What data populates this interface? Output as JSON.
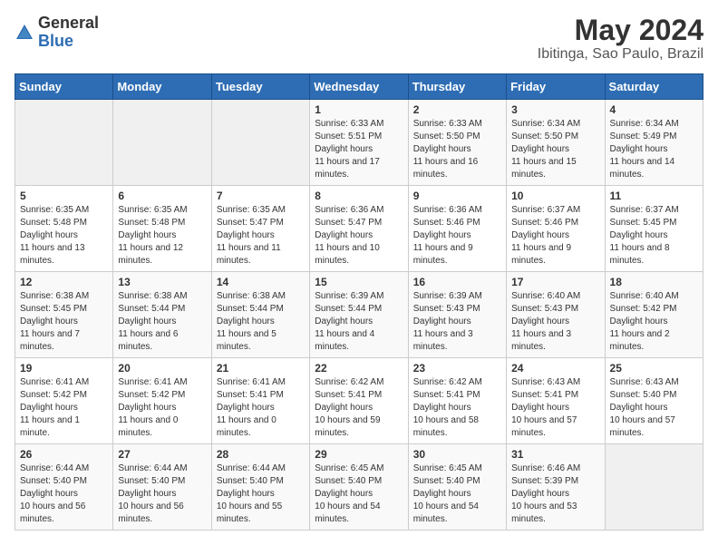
{
  "logo": {
    "general": "General",
    "blue": "Blue"
  },
  "header": {
    "title": "May 2024",
    "subtitle": "Ibitinga, Sao Paulo, Brazil"
  },
  "weekdays": [
    "Sunday",
    "Monday",
    "Tuesday",
    "Wednesday",
    "Thursday",
    "Friday",
    "Saturday"
  ],
  "weeks": [
    [
      {
        "day": "",
        "empty": true
      },
      {
        "day": "",
        "empty": true
      },
      {
        "day": "",
        "empty": true
      },
      {
        "day": "1",
        "sunrise": "6:33 AM",
        "sunset": "5:51 PM",
        "daylight": "11 hours and 17 minutes."
      },
      {
        "day": "2",
        "sunrise": "6:33 AM",
        "sunset": "5:50 PM",
        "daylight": "11 hours and 16 minutes."
      },
      {
        "day": "3",
        "sunrise": "6:34 AM",
        "sunset": "5:50 PM",
        "daylight": "11 hours and 15 minutes."
      },
      {
        "day": "4",
        "sunrise": "6:34 AM",
        "sunset": "5:49 PM",
        "daylight": "11 hours and 14 minutes."
      }
    ],
    [
      {
        "day": "5",
        "sunrise": "6:35 AM",
        "sunset": "5:48 PM",
        "daylight": "11 hours and 13 minutes."
      },
      {
        "day": "6",
        "sunrise": "6:35 AM",
        "sunset": "5:48 PM",
        "daylight": "11 hours and 12 minutes."
      },
      {
        "day": "7",
        "sunrise": "6:35 AM",
        "sunset": "5:47 PM",
        "daylight": "11 hours and 11 minutes."
      },
      {
        "day": "8",
        "sunrise": "6:36 AM",
        "sunset": "5:47 PM",
        "daylight": "11 hours and 10 minutes."
      },
      {
        "day": "9",
        "sunrise": "6:36 AM",
        "sunset": "5:46 PM",
        "daylight": "11 hours and 9 minutes."
      },
      {
        "day": "10",
        "sunrise": "6:37 AM",
        "sunset": "5:46 PM",
        "daylight": "11 hours and 9 minutes."
      },
      {
        "day": "11",
        "sunrise": "6:37 AM",
        "sunset": "5:45 PM",
        "daylight": "11 hours and 8 minutes."
      }
    ],
    [
      {
        "day": "12",
        "sunrise": "6:38 AM",
        "sunset": "5:45 PM",
        "daylight": "11 hours and 7 minutes."
      },
      {
        "day": "13",
        "sunrise": "6:38 AM",
        "sunset": "5:44 PM",
        "daylight": "11 hours and 6 minutes."
      },
      {
        "day": "14",
        "sunrise": "6:38 AM",
        "sunset": "5:44 PM",
        "daylight": "11 hours and 5 minutes."
      },
      {
        "day": "15",
        "sunrise": "6:39 AM",
        "sunset": "5:44 PM",
        "daylight": "11 hours and 4 minutes."
      },
      {
        "day": "16",
        "sunrise": "6:39 AM",
        "sunset": "5:43 PM",
        "daylight": "11 hours and 3 minutes."
      },
      {
        "day": "17",
        "sunrise": "6:40 AM",
        "sunset": "5:43 PM",
        "daylight": "11 hours and 3 minutes."
      },
      {
        "day": "18",
        "sunrise": "6:40 AM",
        "sunset": "5:42 PM",
        "daylight": "11 hours and 2 minutes."
      }
    ],
    [
      {
        "day": "19",
        "sunrise": "6:41 AM",
        "sunset": "5:42 PM",
        "daylight": "11 hours and 1 minute."
      },
      {
        "day": "20",
        "sunrise": "6:41 AM",
        "sunset": "5:42 PM",
        "daylight": "11 hours and 0 minutes."
      },
      {
        "day": "21",
        "sunrise": "6:41 AM",
        "sunset": "5:41 PM",
        "daylight": "11 hours and 0 minutes."
      },
      {
        "day": "22",
        "sunrise": "6:42 AM",
        "sunset": "5:41 PM",
        "daylight": "10 hours and 59 minutes."
      },
      {
        "day": "23",
        "sunrise": "6:42 AM",
        "sunset": "5:41 PM",
        "daylight": "10 hours and 58 minutes."
      },
      {
        "day": "24",
        "sunrise": "6:43 AM",
        "sunset": "5:41 PM",
        "daylight": "10 hours and 57 minutes."
      },
      {
        "day": "25",
        "sunrise": "6:43 AM",
        "sunset": "5:40 PM",
        "daylight": "10 hours and 57 minutes."
      }
    ],
    [
      {
        "day": "26",
        "sunrise": "6:44 AM",
        "sunset": "5:40 PM",
        "daylight": "10 hours and 56 minutes."
      },
      {
        "day": "27",
        "sunrise": "6:44 AM",
        "sunset": "5:40 PM",
        "daylight": "10 hours and 56 minutes."
      },
      {
        "day": "28",
        "sunrise": "6:44 AM",
        "sunset": "5:40 PM",
        "daylight": "10 hours and 55 minutes."
      },
      {
        "day": "29",
        "sunrise": "6:45 AM",
        "sunset": "5:40 PM",
        "daylight": "10 hours and 54 minutes."
      },
      {
        "day": "30",
        "sunrise": "6:45 AM",
        "sunset": "5:40 PM",
        "daylight": "10 hours and 54 minutes."
      },
      {
        "day": "31",
        "sunrise": "6:46 AM",
        "sunset": "5:39 PM",
        "daylight": "10 hours and 53 minutes."
      },
      {
        "day": "",
        "empty": true
      }
    ]
  ],
  "labels": {
    "sunrise": "Sunrise:",
    "sunset": "Sunset:",
    "daylight": "Daylight hours"
  }
}
